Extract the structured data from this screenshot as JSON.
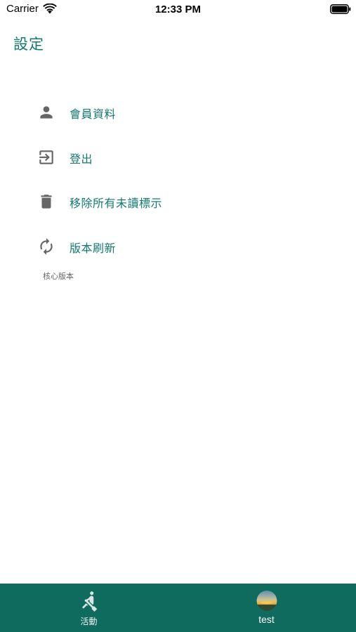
{
  "status_bar": {
    "carrier": "Carrier",
    "time": "12:33 PM",
    "icons": [
      "wifi-icon",
      "battery-icon"
    ]
  },
  "header": {
    "title": "設定"
  },
  "settings": {
    "items": [
      {
        "label": "會員資料",
        "icon": "person-icon"
      },
      {
        "label": "登出",
        "icon": "logout-icon"
      },
      {
        "label": "移除所有未讀標示",
        "icon": "trash-icon"
      },
      {
        "label": "版本刷新",
        "icon": "refresh-icon"
      }
    ],
    "core_version_label": "核心版本"
  },
  "tab_bar": {
    "tabs": [
      {
        "label": "活動",
        "icon": "rowing-icon"
      },
      {
        "label": "test",
        "icon": "avatar"
      }
    ]
  },
  "colors": {
    "accent": "#127a6d",
    "tab_bar": "#106b5f",
    "icon_gray": "#666666"
  }
}
